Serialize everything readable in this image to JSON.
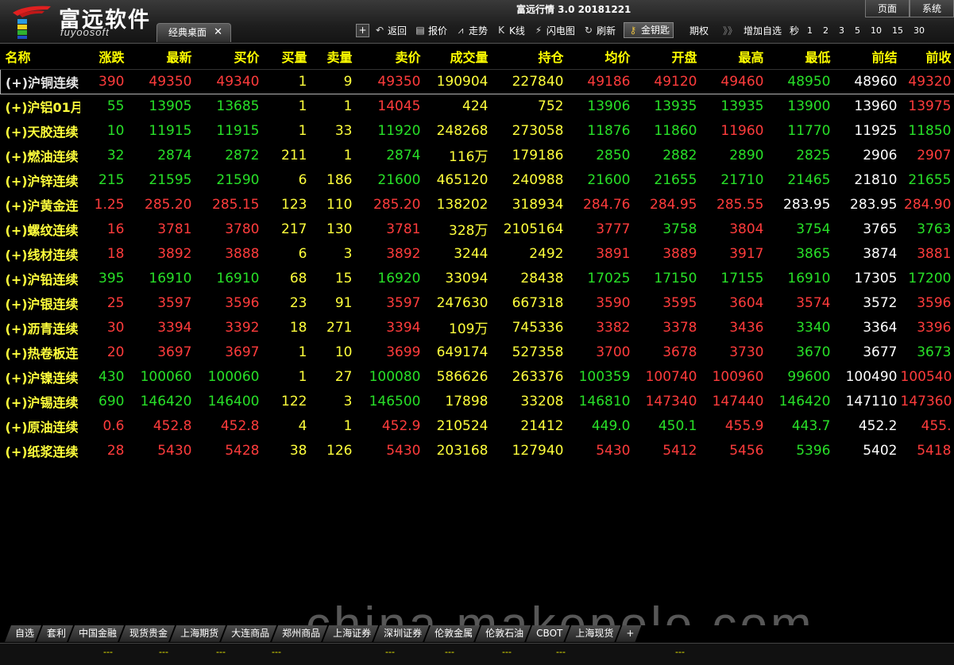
{
  "header": {
    "brand_cn": "富远软件",
    "brand_en": "fuyoosoft",
    "desktop_tab": "经典桌面",
    "close_glyph": "✕",
    "app_title": "富远行情 3.0 20181221",
    "top_tabs": [
      "页面",
      "系统"
    ]
  },
  "toolbar": {
    "plus": "+",
    "items": [
      {
        "icon": "back-icon",
        "glyph": "↶",
        "label": "返回"
      },
      {
        "icon": "quote-icon",
        "glyph": "▤",
        "label": "报价"
      },
      {
        "icon": "trend-icon",
        "glyph": "⩘",
        "label": "走势"
      },
      {
        "icon": "kline-icon",
        "glyph": "K",
        "label": "K线"
      },
      {
        "icon": "lightning-icon",
        "glyph": "⚡",
        "label": "闪电图"
      },
      {
        "icon": "refresh-icon",
        "glyph": "↻",
        "label": "刷新"
      },
      {
        "icon": "key-icon",
        "glyph": "⚷",
        "label": "金钥匙"
      }
    ],
    "option": "期权",
    "more_glyph": "》》",
    "add_watch": "增加自选",
    "sec_label": "秒",
    "intervals": [
      "1",
      "2",
      "3",
      "5",
      "10",
      "15",
      "30"
    ]
  },
  "table": {
    "columns": [
      "名称",
      "涨跌",
      "最新",
      "买价",
      "买量",
      "卖量",
      "卖价",
      "成交量",
      "持仓",
      "均价",
      "开盘",
      "最高",
      "最低",
      "前结",
      "前收"
    ],
    "rows": [
      {
        "name": "(+)沪铜连续",
        "chg": "390",
        "last": "49350",
        "bid": "49340",
        "bidv": "1",
        "askv": "9",
        "ask": "49350",
        "vol": "190904",
        "oi": "227840",
        "avg": "49186",
        "open": "49120",
        "high": "49460",
        "low": "48950",
        "presettle": "48960",
        "preclose": "49320",
        "cls": {
          "chg": "up",
          "last": "up",
          "bid": "up",
          "ask": "up",
          "avg": "up",
          "open": "up",
          "high": "up",
          "low": "dn",
          "preclose": "up"
        }
      },
      {
        "name": "(+)沪铝01月",
        "chg": "55",
        "last": "13905",
        "bid": "13685",
        "bidv": "1",
        "askv": "1",
        "ask": "14045",
        "vol": "424",
        "oi": "752",
        "avg": "13906",
        "open": "13935",
        "high": "13935",
        "low": "13900",
        "presettle": "13960",
        "preclose": "13975",
        "cls": {
          "chg": "dn",
          "last": "dn",
          "bid": "dn",
          "ask": "up",
          "avg": "dn",
          "open": "dn",
          "high": "dn",
          "low": "dn",
          "preclose": "up"
        }
      },
      {
        "name": "(+)天胶连续",
        "chg": "10",
        "last": "11915",
        "bid": "11915",
        "bidv": "1",
        "askv": "33",
        "ask": "11920",
        "vol": "248268",
        "oi": "273058",
        "avg": "11876",
        "open": "11860",
        "high": "11960",
        "low": "11770",
        "presettle": "11925",
        "preclose": "11850",
        "cls": {
          "chg": "dn",
          "last": "dn",
          "bid": "dn",
          "ask": "dn",
          "avg": "dn",
          "open": "dn",
          "high": "up",
          "low": "dn",
          "preclose": "dn"
        }
      },
      {
        "name": "(+)燃油连续",
        "chg": "32",
        "last": "2874",
        "bid": "2872",
        "bidv": "211",
        "askv": "1",
        "ask": "2874",
        "vol": "116万",
        "oi": "179186",
        "avg": "2850",
        "open": "2882",
        "high": "2890",
        "low": "2825",
        "presettle": "2906",
        "preclose": "2907",
        "cls": {
          "chg": "dn",
          "last": "dn",
          "bid": "dn",
          "ask": "dn",
          "avg": "dn",
          "open": "dn",
          "high": "dn",
          "low": "dn",
          "preclose": "up"
        }
      },
      {
        "name": "(+)沪锌连续",
        "chg": "215",
        "last": "21595",
        "bid": "21590",
        "bidv": "6",
        "askv": "186",
        "ask": "21600",
        "vol": "465120",
        "oi": "240988",
        "avg": "21600",
        "open": "21655",
        "high": "21710",
        "low": "21465",
        "presettle": "21810",
        "preclose": "21655",
        "cls": {
          "chg": "dn",
          "last": "dn",
          "bid": "dn",
          "ask": "dn",
          "avg": "dn",
          "open": "dn",
          "high": "dn",
          "low": "dn",
          "preclose": "dn"
        }
      },
      {
        "name": "(+)沪黄金连",
        "chg": "1.25",
        "last": "285.20",
        "bid": "285.15",
        "bidv": "123",
        "askv": "110",
        "ask": "285.20",
        "vol": "138202",
        "oi": "318934",
        "avg": "284.76",
        "open": "284.95",
        "high": "285.55",
        "low": "283.95",
        "presettle": "283.95",
        "preclose": "284.90",
        "cls": {
          "chg": "up",
          "last": "up",
          "bid": "up",
          "ask": "up",
          "avg": "up",
          "open": "up",
          "high": "up",
          "low": "fl",
          "preclose": "up"
        }
      },
      {
        "name": "(+)螺纹连续",
        "chg": "16",
        "last": "3781",
        "bid": "3780",
        "bidv": "217",
        "askv": "130",
        "ask": "3781",
        "vol": "328万",
        "oi": "2105164",
        "avg": "3777",
        "open": "3758",
        "high": "3804",
        "low": "3754",
        "presettle": "3765",
        "preclose": "3763",
        "cls": {
          "chg": "up",
          "last": "up",
          "bid": "up",
          "ask": "up",
          "avg": "up",
          "open": "dn",
          "high": "up",
          "low": "dn",
          "preclose": "dn"
        }
      },
      {
        "name": "(+)线材连续",
        "chg": "18",
        "last": "3892",
        "bid": "3888",
        "bidv": "6",
        "askv": "3",
        "ask": "3892",
        "vol": "3244",
        "oi": "2492",
        "avg": "3891",
        "open": "3889",
        "high": "3917",
        "low": "3865",
        "presettle": "3874",
        "preclose": "3881",
        "cls": {
          "chg": "up",
          "last": "up",
          "bid": "up",
          "ask": "up",
          "avg": "up",
          "open": "up",
          "high": "up",
          "low": "dn",
          "preclose": "up"
        }
      },
      {
        "name": "(+)沪铅连续",
        "chg": "395",
        "last": "16910",
        "bid": "16910",
        "bidv": "68",
        "askv": "15",
        "ask": "16920",
        "vol": "33094",
        "oi": "28438",
        "avg": "17025",
        "open": "17150",
        "high": "17155",
        "low": "16910",
        "presettle": "17305",
        "preclose": "17200",
        "cls": {
          "chg": "dn",
          "last": "dn",
          "bid": "dn",
          "ask": "dn",
          "avg": "dn",
          "open": "dn",
          "high": "dn",
          "low": "dn",
          "preclose": "dn"
        }
      },
      {
        "name": "(+)沪银连续",
        "chg": "25",
        "last": "3597",
        "bid": "3596",
        "bidv": "23",
        "askv": "91",
        "ask": "3597",
        "vol": "247630",
        "oi": "667318",
        "avg": "3590",
        "open": "3595",
        "high": "3604",
        "low": "3574",
        "presettle": "3572",
        "preclose": "3596",
        "cls": {
          "chg": "up",
          "last": "up",
          "bid": "up",
          "ask": "up",
          "avg": "up",
          "open": "up",
          "high": "up",
          "low": "up",
          "preclose": "up"
        }
      },
      {
        "name": "(+)沥青连续",
        "chg": "30",
        "last": "3394",
        "bid": "3392",
        "bidv": "18",
        "askv": "271",
        "ask": "3394",
        "vol": "109万",
        "oi": "745336",
        "avg": "3382",
        "open": "3378",
        "high": "3436",
        "low": "3340",
        "presettle": "3364",
        "preclose": "3396",
        "cls": {
          "chg": "up",
          "last": "up",
          "bid": "up",
          "ask": "up",
          "avg": "up",
          "open": "up",
          "high": "up",
          "low": "dn",
          "preclose": "up"
        }
      },
      {
        "name": "(+)热卷板连",
        "chg": "20",
        "last": "3697",
        "bid": "3697",
        "bidv": "1",
        "askv": "10",
        "ask": "3699",
        "vol": "649174",
        "oi": "527358",
        "avg": "3700",
        "open": "3678",
        "high": "3730",
        "low": "3670",
        "presettle": "3677",
        "preclose": "3673",
        "cls": {
          "chg": "up",
          "last": "up",
          "bid": "up",
          "ask": "up",
          "avg": "up",
          "open": "up",
          "high": "up",
          "low": "dn",
          "preclose": "dn"
        }
      },
      {
        "name": "(+)沪镍连续",
        "chg": "430",
        "last": "100060",
        "bid": "100060",
        "bidv": "1",
        "askv": "27",
        "ask": "100080",
        "vol": "586626",
        "oi": "263376",
        "avg": "100359",
        "open": "100740",
        "high": "100960",
        "low": "99600",
        "presettle": "100490",
        "preclose": "100540",
        "cls": {
          "chg": "dn",
          "last": "dn",
          "bid": "dn",
          "ask": "dn",
          "avg": "dn",
          "open": "up",
          "high": "up",
          "low": "dn",
          "preclose": "up"
        }
      },
      {
        "name": "(+)沪锡连续",
        "chg": "690",
        "last": "146420",
        "bid": "146400",
        "bidv": "122",
        "askv": "3",
        "ask": "146500",
        "vol": "17898",
        "oi": "33208",
        "avg": "146810",
        "open": "147340",
        "high": "147440",
        "low": "146420",
        "presettle": "147110",
        "preclose": "147360",
        "cls": {
          "chg": "dn",
          "last": "dn",
          "bid": "dn",
          "ask": "dn",
          "avg": "dn",
          "open": "up",
          "high": "up",
          "low": "dn",
          "preclose": "up"
        }
      },
      {
        "name": "(+)原油连续",
        "chg": "0.6",
        "last": "452.8",
        "bid": "452.8",
        "bidv": "4",
        "askv": "1",
        "ask": "452.9",
        "vol": "210524",
        "oi": "21412",
        "avg": "449.0",
        "open": "450.1",
        "high": "455.9",
        "low": "443.7",
        "presettle": "452.2",
        "preclose": "455.",
        "cls": {
          "chg": "up",
          "last": "up",
          "bid": "up",
          "ask": "up",
          "avg": "dn",
          "open": "dn",
          "high": "up",
          "low": "dn",
          "preclose": "up"
        }
      },
      {
        "name": "(+)纸浆连续",
        "chg": "28",
        "last": "5430",
        "bid": "5428",
        "bidv": "38",
        "askv": "126",
        "ask": "5430",
        "vol": "203168",
        "oi": "127940",
        "avg": "5430",
        "open": "5412",
        "high": "5456",
        "low": "5396",
        "presettle": "5402",
        "preclose": "5418",
        "cls": {
          "chg": "up",
          "last": "up",
          "bid": "up",
          "ask": "up",
          "avg": "up",
          "open": "up",
          "high": "up",
          "low": "dn",
          "preclose": "up"
        }
      }
    ]
  },
  "bottom": {
    "tabs": [
      "自选",
      "套利",
      "中国金融",
      "现货贵金",
      "上海期货",
      "大连商品",
      "郑州商品",
      "上海证券",
      "深圳证券",
      "伦敦金属",
      "伦敦石油",
      "CBOT",
      "上海现货",
      "+"
    ],
    "dash": "---"
  },
  "watermark": "china.makepolo.com",
  "colors": {
    "up": "#ff3c3c",
    "down": "#28e028",
    "flat": "#ffffff",
    "header": "#ffff00"
  }
}
